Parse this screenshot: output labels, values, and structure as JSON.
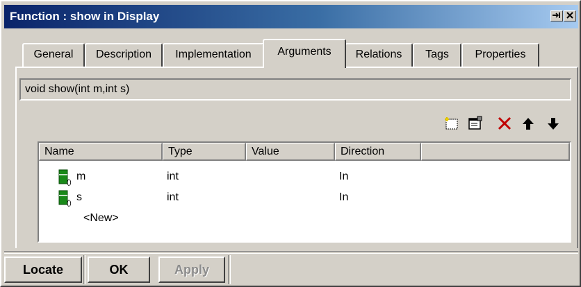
{
  "window": {
    "title": "Function : show in Display"
  },
  "tabs": [
    {
      "label": "General"
    },
    {
      "label": "Description"
    },
    {
      "label": "Implementation"
    },
    {
      "label": "Arguments",
      "active": true
    },
    {
      "label": "Relations"
    },
    {
      "label": "Tags"
    },
    {
      "label": "Properties"
    }
  ],
  "signature": "void show(int m,int s)",
  "toolbar": {
    "icons": [
      "new-argument-icon",
      "properties-icon",
      "delete-icon",
      "move-up-icon",
      "move-down-icon"
    ]
  },
  "grid": {
    "columns": [
      "Name",
      "Type",
      "Value",
      "Direction"
    ],
    "rows": [
      {
        "name": "m",
        "type": "int",
        "value": "",
        "direction": "In"
      },
      {
        "name": "s",
        "type": "int",
        "value": "",
        "direction": "In"
      }
    ],
    "new_row_label": "<New>"
  },
  "buttons": {
    "locate": "Locate",
    "ok": "OK",
    "apply": "Apply"
  },
  "colors": {
    "titlebar_start": "#0a246a",
    "titlebar_end": "#a6caf0",
    "delete_red": "#c00000",
    "arg_icon_green": "#1a8a1a"
  }
}
